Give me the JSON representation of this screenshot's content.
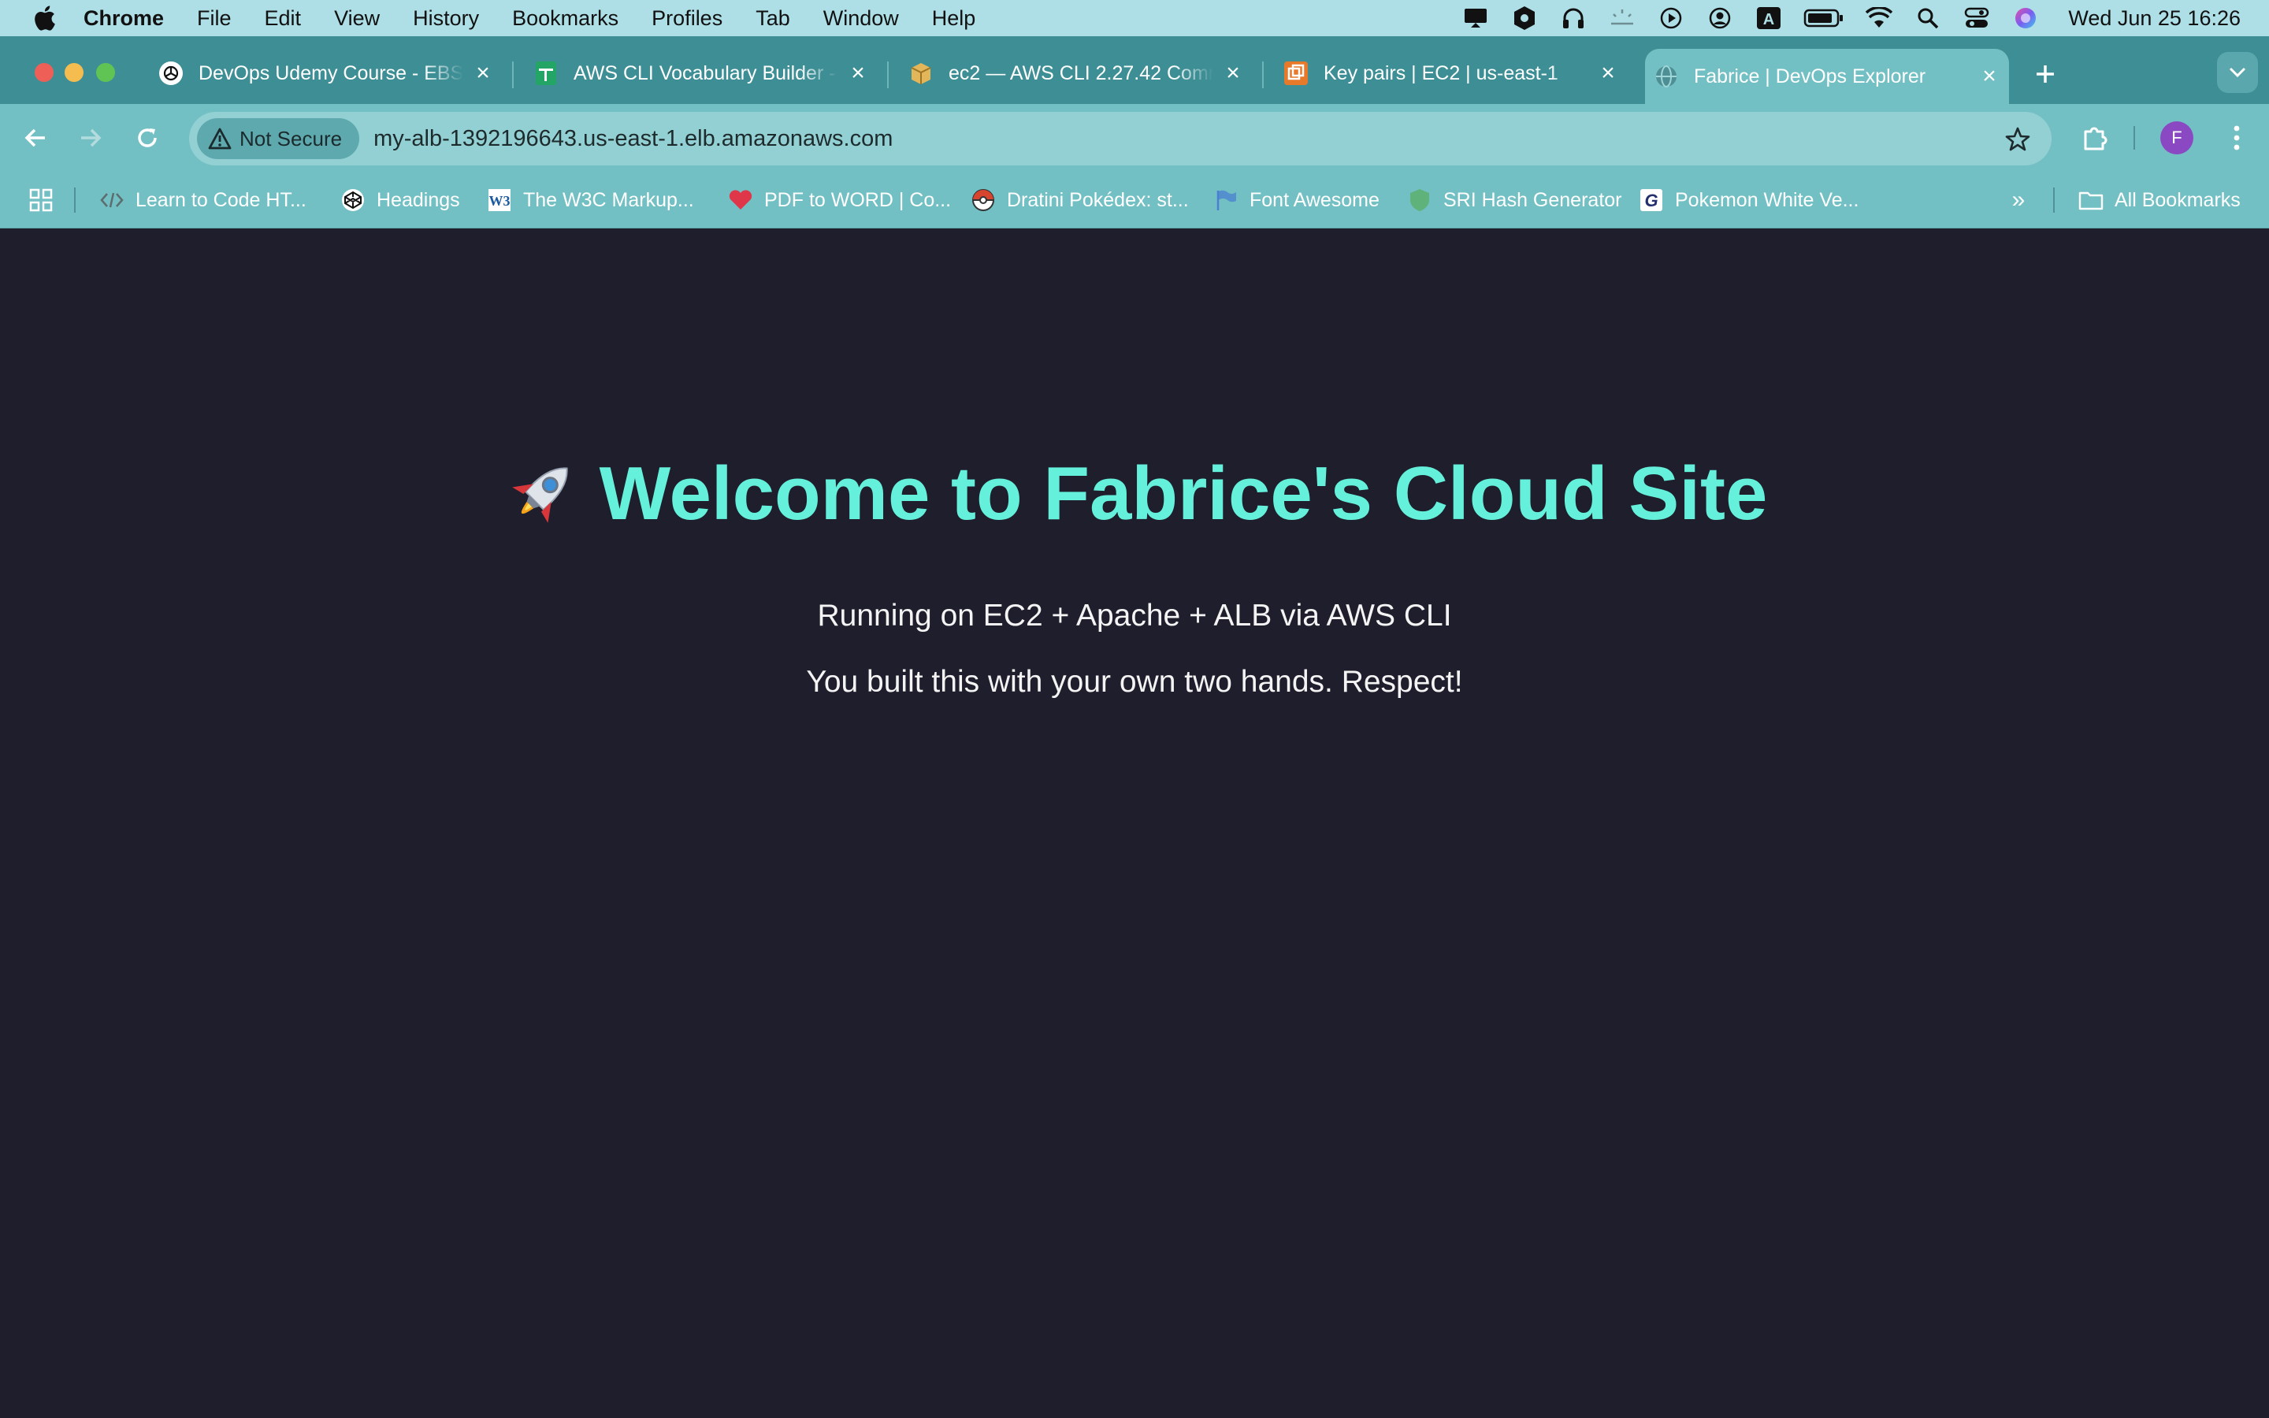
{
  "menubar": {
    "app": "Chrome",
    "items": [
      "File",
      "Edit",
      "View",
      "History",
      "Bookmarks",
      "Profiles",
      "Tab",
      "Window",
      "Help"
    ],
    "clock": "Wed Jun 25  16:26",
    "status_icons": [
      "display-icon",
      "shield-icon",
      "headphones-icon",
      "brightness-icon",
      "play-icon",
      "user-circle-icon",
      "keyboard-a-icon",
      "battery-icon",
      "wifi-icon",
      "search-icon",
      "control-center-icon",
      "siri-icon"
    ]
  },
  "tabs": [
    {
      "title": "DevOps Udemy Course - EBS",
      "icon": "openai-icon",
      "active": false
    },
    {
      "title": "AWS CLI Vocabulary Builder -",
      "icon": "sheets-icon",
      "active": false
    },
    {
      "title": "ec2 — AWS CLI 2.27.42 Comm",
      "icon": "package-icon",
      "active": false
    },
    {
      "title": "Key pairs | EC2 | us-east-1",
      "icon": "aws-icon",
      "active": false
    },
    {
      "title": "Fabrice | DevOps Explorer",
      "icon": "globe-icon",
      "active": true
    }
  ],
  "omnibox": {
    "security_label": "Not Secure",
    "url": "my-alb-1392196643.us-east-1.elb.amazonaws.com"
  },
  "profile_initial": "F",
  "bookmarks": [
    {
      "label": "Learn to Code HT...",
      "icon": "code-icon"
    },
    {
      "label": "Headings",
      "icon": "codepen-icon"
    },
    {
      "label": "The W3C Markup...",
      "icon": "w3c-icon"
    },
    {
      "label": "PDF to WORD | Co...",
      "icon": "heart-icon"
    },
    {
      "label": "Dratini Pokédex: st...",
      "icon": "pokeball-icon"
    },
    {
      "label": "Font Awesome",
      "icon": "flag-icon"
    },
    {
      "label": "SRI Hash Generator",
      "icon": "shield-icon"
    },
    {
      "label": "Pokemon White Ve...",
      "icon": "g-icon"
    }
  ],
  "all_bookmarks_label": "All Bookmarks",
  "page": {
    "title": "Welcome to Fabrice's Cloud Site",
    "line1": "Running on EC2 + Apache + ALB via AWS CLI",
    "line2": "You built this with your own two hands. Respect!"
  },
  "colors": {
    "page_bg": "#1e1e2c",
    "title_color": "#64f0da",
    "chrome_frame": "#3e8f95",
    "chrome_toolbar": "#73c0c4"
  }
}
